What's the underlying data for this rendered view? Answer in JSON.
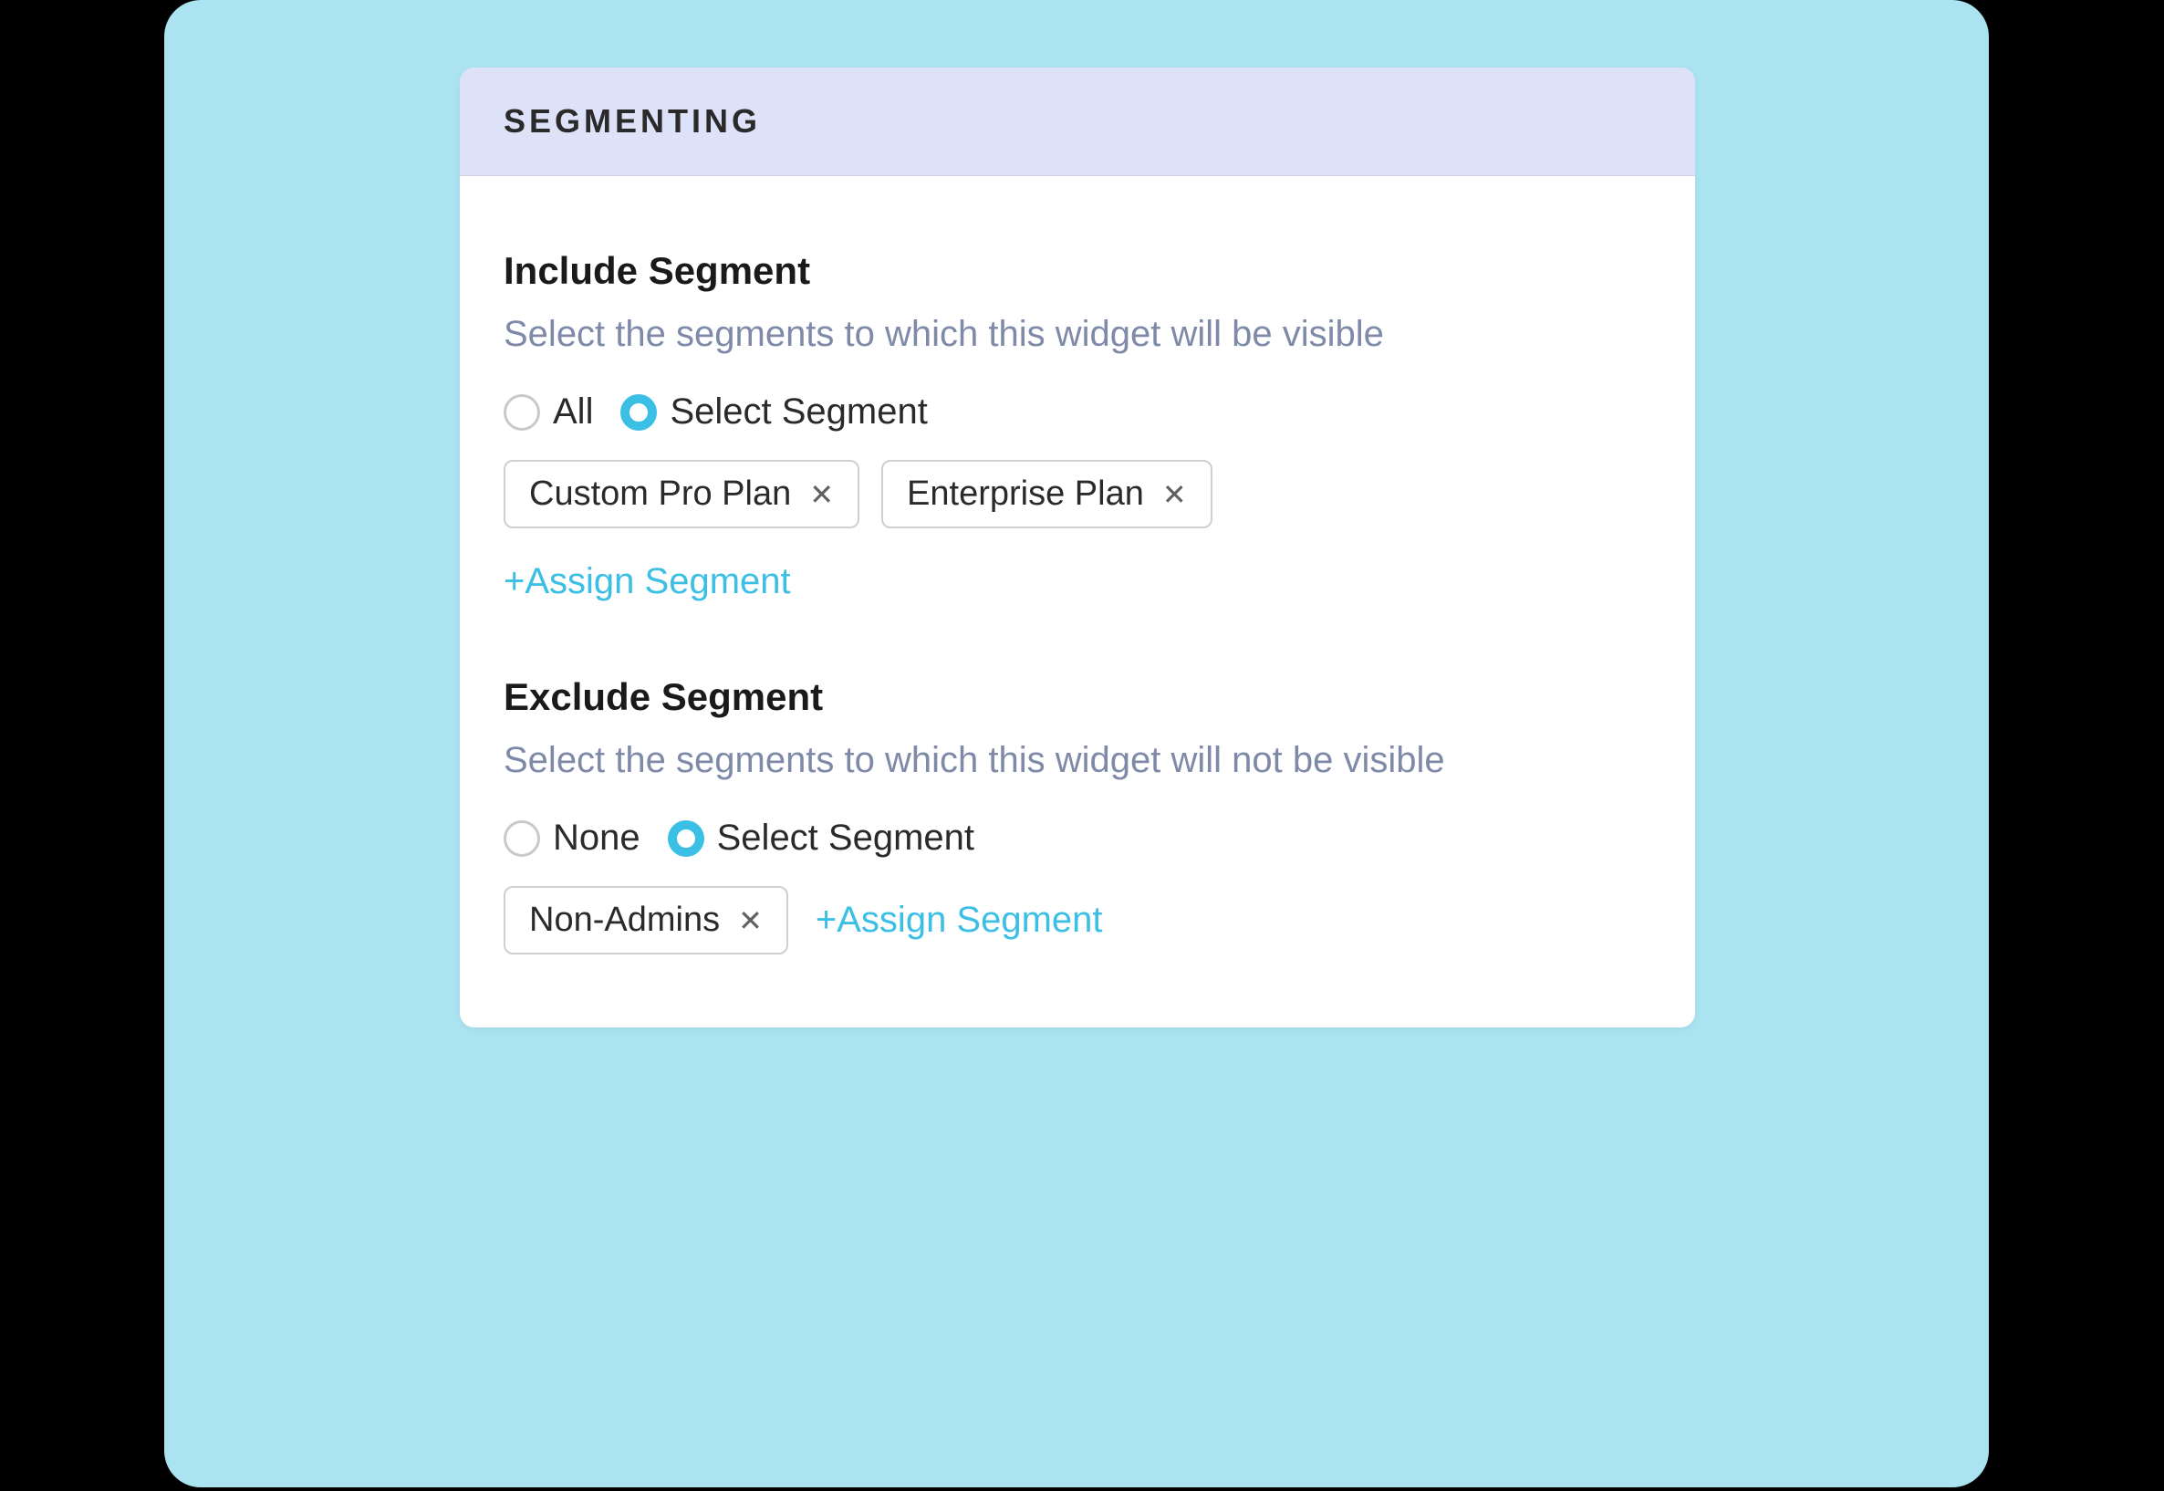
{
  "colors": {
    "accent": "#3cbfe5",
    "headerBg": "#dde2f8",
    "outerBg": "#abe3f0",
    "muted": "#7e8aa8"
  },
  "panel": {
    "title": "SEGMENTING"
  },
  "include": {
    "title": "Include Segment",
    "description": "Select the segments to which this widget will be visible",
    "radios": {
      "all": {
        "label": "All",
        "checked": false
      },
      "select": {
        "label": "Select Segment",
        "checked": true
      }
    },
    "chips": [
      {
        "label": "Custom Pro Plan"
      },
      {
        "label": "Enterprise Plan"
      }
    ],
    "assign_label": "+Assign Segment"
  },
  "exclude": {
    "title": "Exclude Segment",
    "description": "Select the segments to which this widget will not be visible",
    "radios": {
      "none": {
        "label": "None",
        "checked": false
      },
      "select": {
        "label": "Select Segment",
        "checked": true
      }
    },
    "chips": [
      {
        "label": "Non-Admins"
      }
    ],
    "assign_label": "+Assign Segment"
  }
}
